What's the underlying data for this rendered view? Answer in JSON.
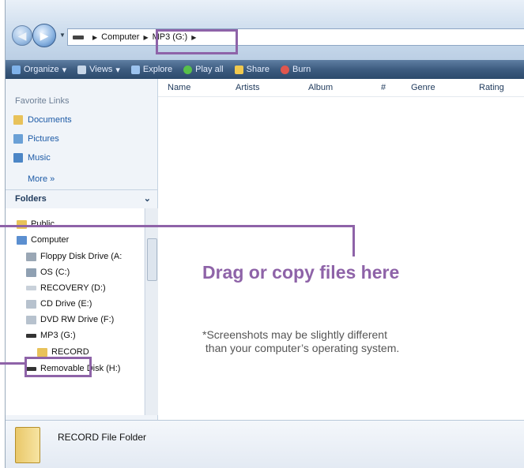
{
  "address": {
    "crumbs": [
      "Computer",
      "MP3 (G:)"
    ]
  },
  "toolbar": {
    "items": [
      {
        "label": "Organize",
        "icon": "organize-icon",
        "color": "#7fb2ea"
      },
      {
        "label": "Views",
        "icon": "views-icon",
        "color": "#c7d6e8"
      },
      {
        "label": "Explore",
        "icon": "explore-icon",
        "color": "#9cc3ef"
      },
      {
        "label": "Play all",
        "icon": "play-icon",
        "color": "#58c04a"
      },
      {
        "label": "Share",
        "icon": "share-icon",
        "color": "#f1c94e"
      },
      {
        "label": "Burn",
        "icon": "burn-icon",
        "color": "#e0564d"
      }
    ]
  },
  "favorites": {
    "title": "Favorite Links",
    "items": [
      "Documents",
      "Pictures",
      "Music"
    ],
    "more": "More »"
  },
  "folders": {
    "title": "Folders",
    "tree": [
      "Public",
      "Computer",
      "Floppy Disk Drive (A:",
      "OS (C:)",
      "RECOVERY (D:)",
      "CD Drive (E:)",
      "DVD RW Drive (F:)",
      "MP3 (G:)",
      "RECORD",
      "Removable Disk (H:)"
    ]
  },
  "columns": [
    "Name",
    "Artists",
    "Album",
    "#",
    "Genre",
    "Rating"
  ],
  "details": {
    "text": "RECORD File Folder"
  },
  "callout": {
    "drag": "Drag or copy files here",
    "note_line1": "*Screenshots may be slightly different",
    "note_line2": " than your computer’s operating system."
  },
  "colors": {
    "accent": "#8e63a8"
  }
}
